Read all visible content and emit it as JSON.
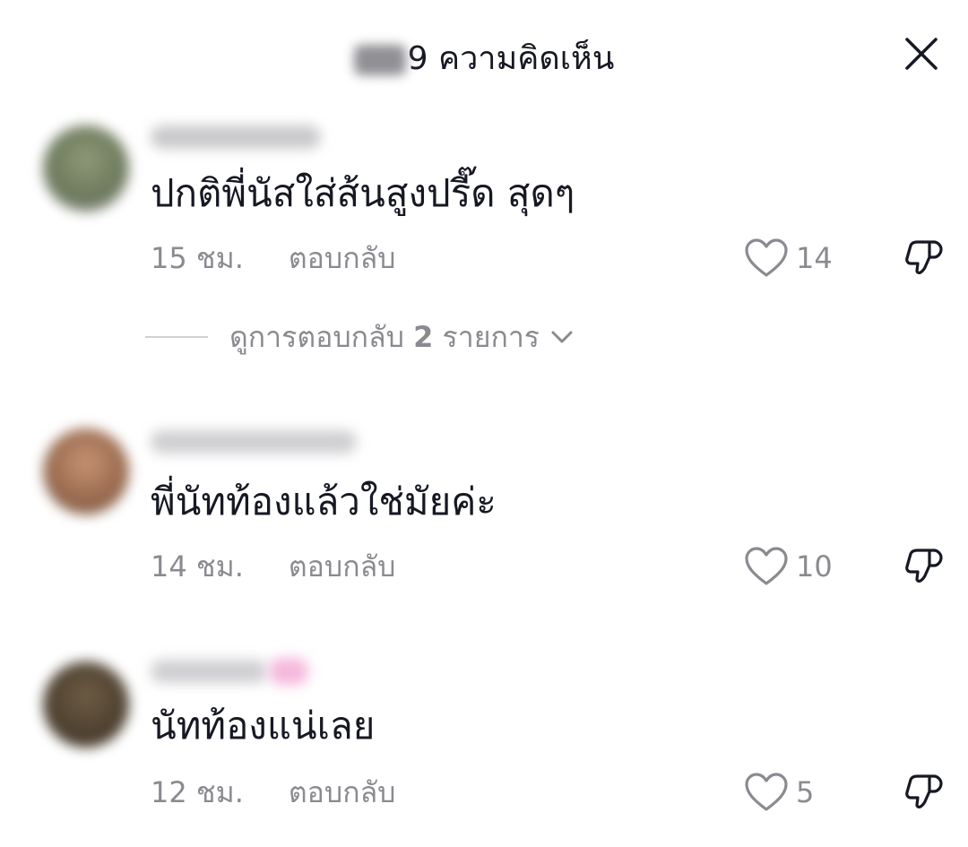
{
  "header": {
    "count_visible": "9",
    "title": "ความคิดเห็น"
  },
  "comments": [
    {
      "text": "ปกติพี่นัสใส่ส้นสูงปรี๊ด สุดๆ",
      "time": "15 ชม.",
      "reply_label": "ตอบกลับ",
      "likes": "14",
      "avatar_color": "#7f8a6a",
      "view_replies": {
        "prefix": "ดูการตอบกลับ",
        "count": "2",
        "suffix": "รายการ"
      }
    },
    {
      "text": "พี่นัทท้องแล้วใช่มัยค่ะ",
      "time": "14 ชม.",
      "reply_label": "ตอบกลับ",
      "likes": "10",
      "avatar_color": "#a07a5e"
    },
    {
      "text": "นัทท้องแน่เลย",
      "time": "12 ชม.",
      "reply_label": "ตอบกลับ",
      "likes": "5",
      "avatar_color": "#5a4a36"
    }
  ],
  "icons": {
    "close": "close-icon",
    "like": "heart-outline-icon",
    "dislike": "thumbs-down-icon",
    "chevron": "chevron-down-icon"
  },
  "colors": {
    "text_primary": "#161823",
    "text_secondary": "#8a8b91",
    "divider": "#d0d0d3"
  }
}
